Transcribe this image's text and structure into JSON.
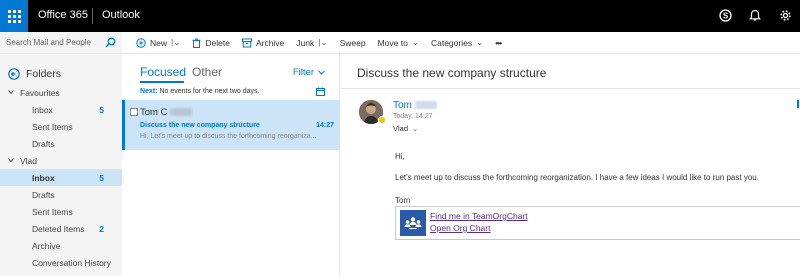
{
  "topbar": {
    "suite": "Office 365",
    "app": "Outlook",
    "icons": [
      "skype-icon",
      "bell-icon",
      "gear-icon"
    ]
  },
  "search": {
    "placeholder": "Search Mail and People"
  },
  "commands": {
    "new": "New",
    "delete": "Delete",
    "archive": "Archive",
    "junk": "Junk",
    "sweep": "Sweep",
    "move_to": "Move to",
    "categories": "Categories",
    "more": "•••"
  },
  "folders": {
    "title": "Folders",
    "favourites": {
      "label": "Favourites",
      "items": [
        {
          "label": "Inbox",
          "count": "5"
        },
        {
          "label": "Sent Items",
          "count": ""
        },
        {
          "label": "Drafts",
          "count": ""
        }
      ]
    },
    "account": {
      "label": "Vlad",
      "items": [
        {
          "label": "Inbox",
          "count": "5"
        },
        {
          "label": "Drafts",
          "count": ""
        },
        {
          "label": "Sent Items",
          "count": ""
        },
        {
          "label": "Deleted Items",
          "count": "2"
        },
        {
          "label": "Archive",
          "count": ""
        },
        {
          "label": "Conversation History",
          "count": ""
        }
      ]
    }
  },
  "list": {
    "tab_focused": "Focused",
    "tab_other": "Other",
    "filter": "Filter",
    "next_label": "Next:",
    "next_text": " No events for the next two days.",
    "message": {
      "sender": "Tom C",
      "subject": "Discuss the new company structure",
      "time": "14:27",
      "preview": "Hi,   Let's meet up to discuss the forthcoming reorganiza..."
    }
  },
  "reading": {
    "subject": "Discuss the new company structure",
    "from": "Tom",
    "date": "Today, 14:27",
    "to": "Vlad",
    "body": {
      "greeting": "Hi,",
      "para": "Let's meet up to discuss the forthcoming reorganization.  I have a few ideas I would like to run past you.",
      "signoff": "Tom"
    },
    "card": {
      "link1": "Find me in TeamOrgChart",
      "link2": "Open Org Chart"
    }
  },
  "colors": {
    "accent": "#0078d4",
    "topbar": "#000000",
    "selected": "#cce4f7",
    "visited_link": "#5a2d91"
  }
}
